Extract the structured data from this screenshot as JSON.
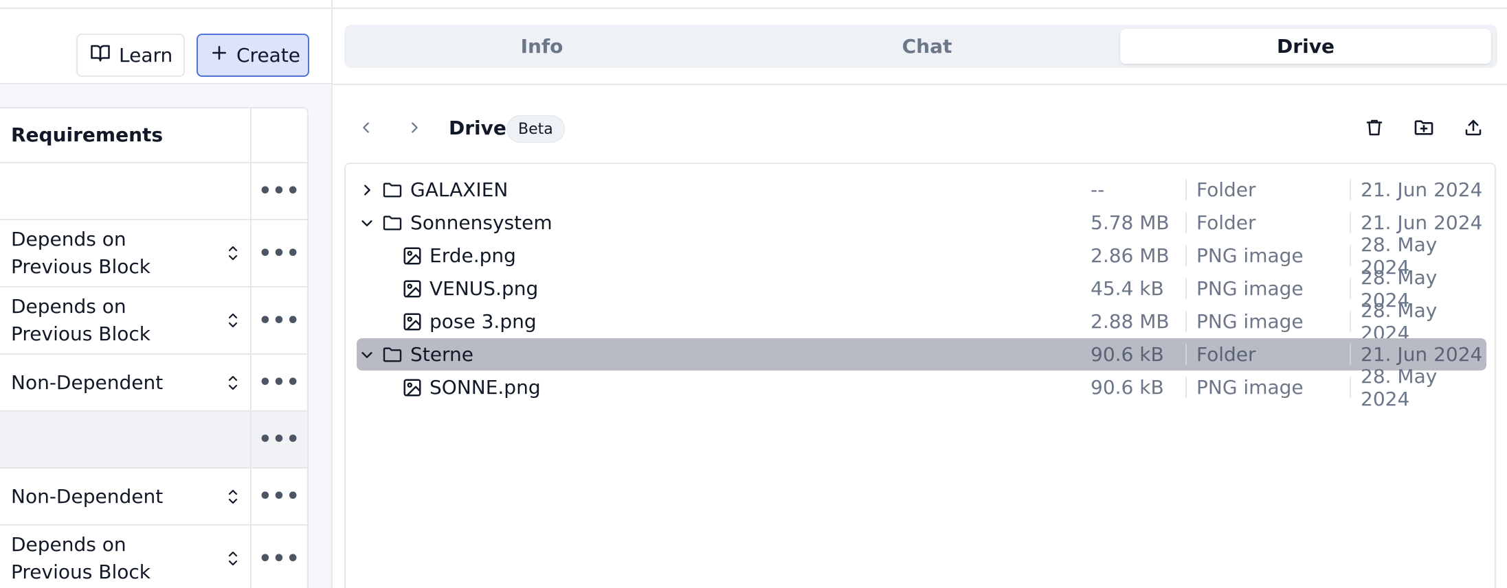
{
  "toolbar": {
    "learn_label": "Learn",
    "create_label": "Create"
  },
  "requirements": {
    "header": "Requirements",
    "rows": [
      {
        "value": "",
        "more": "•••"
      },
      {
        "value": "Depends on Previous Block",
        "more": "•••"
      },
      {
        "value": "Depends on Previous Block",
        "more": "•••"
      },
      {
        "value": "Non-Dependent",
        "more": "•••"
      },
      {
        "value": "",
        "more": "•••"
      },
      {
        "value": "Non-Dependent",
        "more": "•••"
      },
      {
        "value": "Depends on Previous Block",
        "more": "•••"
      }
    ]
  },
  "tabs": [
    {
      "label": "Info",
      "active": false
    },
    {
      "label": "Chat",
      "active": false
    },
    {
      "label": "Drive",
      "active": true
    }
  ],
  "drive": {
    "title": "Drive",
    "badge": "Beta",
    "rows": [
      {
        "name": "GALAXIEN",
        "size": "--",
        "kind": "Folder",
        "date": "21. Jun 2024",
        "type": "folder",
        "expanded": false,
        "depth": 0
      },
      {
        "name": "Sonnensystem",
        "size": "5.78 MB",
        "kind": "Folder",
        "date": "21. Jun 2024",
        "type": "folder",
        "expanded": true,
        "depth": 0
      },
      {
        "name": "Erde.png",
        "size": "2.86 MB",
        "kind": "PNG image",
        "date": "28. May 2024",
        "type": "image",
        "depth": 1
      },
      {
        "name": "VENUS.png",
        "size": "45.4 kB",
        "kind": "PNG image",
        "date": "28. May 2024",
        "type": "image",
        "depth": 1
      },
      {
        "name": "pose 3.png",
        "size": "2.88 MB",
        "kind": "PNG image",
        "date": "28. May 2024",
        "type": "image",
        "depth": 1
      },
      {
        "name": "Sterne",
        "size": "90.6 kB",
        "kind": "Folder",
        "date": "21. Jun 2024",
        "type": "folder",
        "expanded": true,
        "depth": 0,
        "selected": true
      },
      {
        "name": "SONNE.png",
        "size": "90.6 kB",
        "kind": "PNG image",
        "date": "28. May 2024",
        "type": "image",
        "depth": 1
      }
    ]
  },
  "colors": {
    "accent": "#4f73d6",
    "accent_bg": "#dbe4fb",
    "selected_row": "#b8bbc4",
    "muted_text": "#6b7689"
  }
}
